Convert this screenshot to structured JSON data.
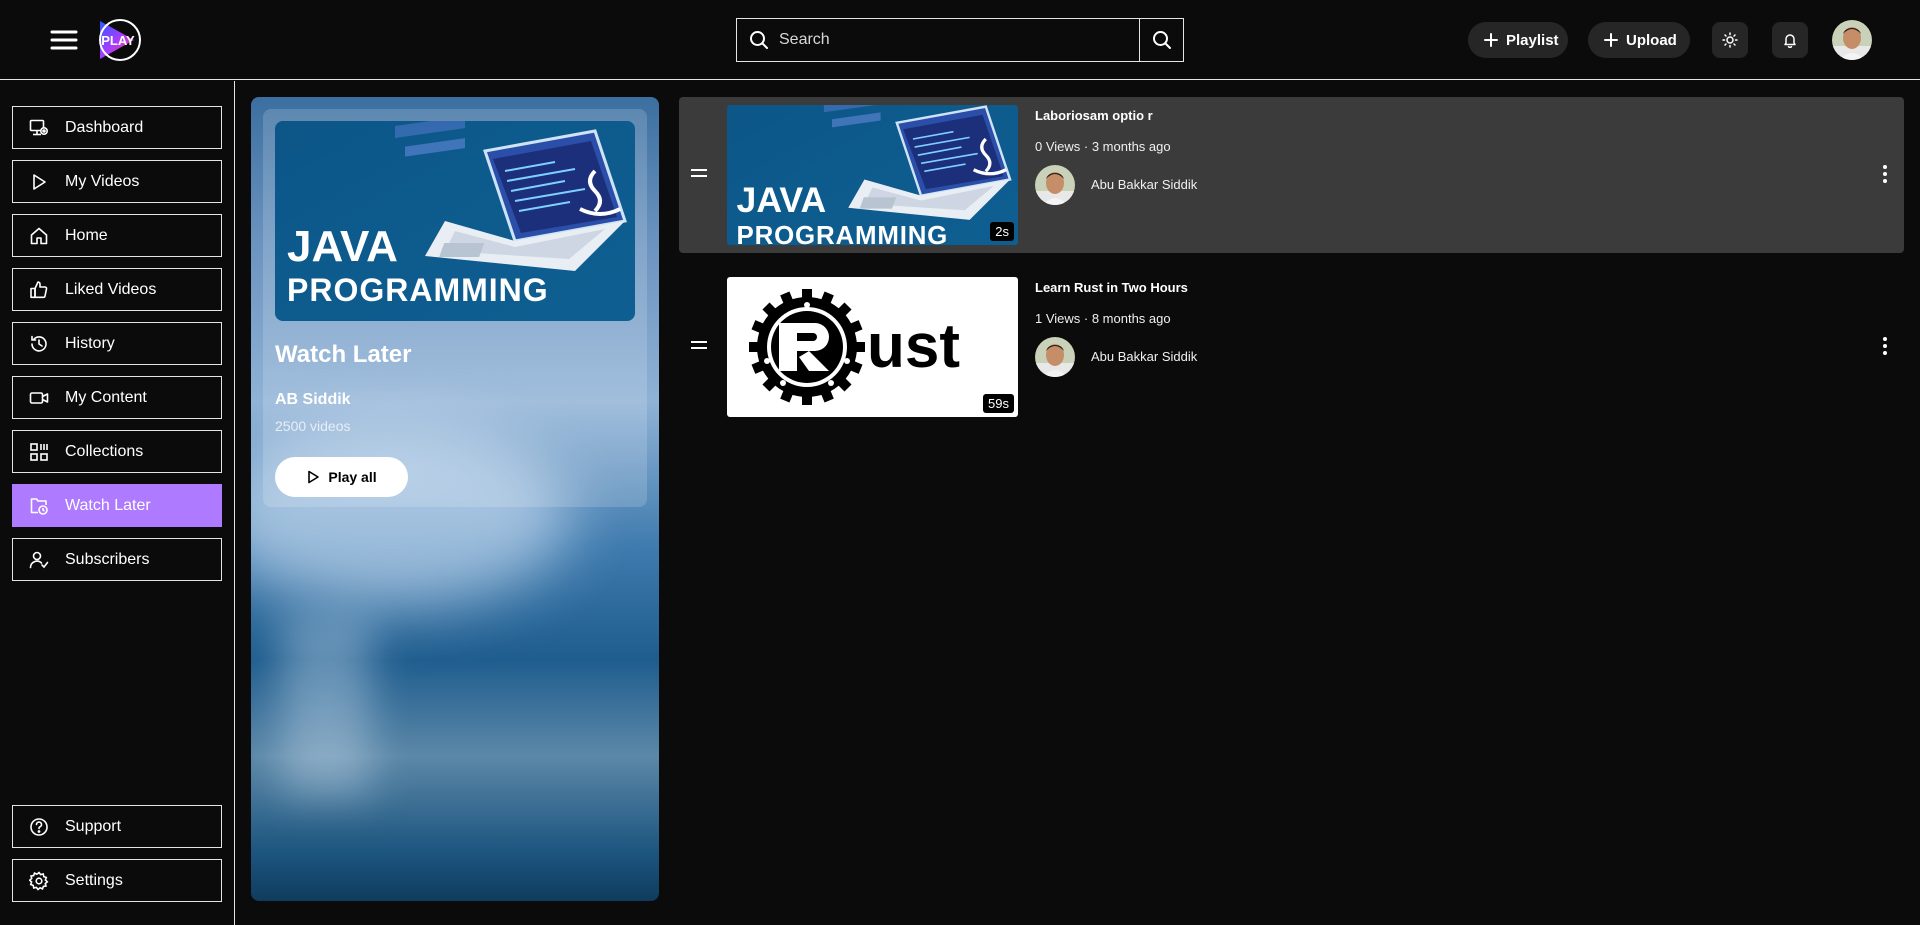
{
  "header": {
    "logo_text": "PLAY",
    "search": {
      "placeholder": "Search",
      "value": ""
    },
    "playlist_label": "Playlist",
    "upload_label": "Upload",
    "icons": [
      "menu-icon",
      "search-icon",
      "plus-icon",
      "sun-icon",
      "bell-icon",
      "avatar"
    ]
  },
  "sidebar": {
    "items": [
      {
        "label": "Dashboard",
        "icon": "monitor-icon",
        "active": false
      },
      {
        "label": "My Videos",
        "icon": "play-icon",
        "active": false
      },
      {
        "label": "Home",
        "icon": "home-icon",
        "active": false
      },
      {
        "label": "Liked Videos",
        "icon": "thumbs-up-icon",
        "active": false
      },
      {
        "label": "History",
        "icon": "history-icon",
        "active": false
      },
      {
        "label": "My Content",
        "icon": "video-camera-icon",
        "active": false
      },
      {
        "label": "Collections",
        "icon": "collections-icon",
        "active": false
      },
      {
        "label": "Watch Later",
        "icon": "folder-clock-icon",
        "active": true
      },
      {
        "label": "Subscribers",
        "icon": "user-check-icon",
        "active": false
      }
    ],
    "bottom_items": [
      {
        "label": "Support",
        "icon": "help-circle-icon"
      },
      {
        "label": "Settings",
        "icon": "gear-icon"
      }
    ],
    "active_color": "#ae7aff"
  },
  "playlist": {
    "title": "Watch Later",
    "owner": "AB Siddik",
    "count": "2500 videos",
    "play_all_label": "Play all",
    "thumb_line1": "JAVA",
    "thumb_line2": "PROGRAMMING"
  },
  "videos": [
    {
      "title": "Laboriosam optio r",
      "meta": "0 Views · 3 months ago",
      "author": "Abu Bakkar Siddik",
      "duration": "2s",
      "thumb_line1": "JAVA",
      "thumb_line2": "PROGRAMMING"
    },
    {
      "title": "Learn Rust in Two Hours",
      "meta": "1 Views · 8 months ago",
      "author": "Abu Bakkar Siddik",
      "duration": "59s",
      "thumb_text": "ust"
    }
  ]
}
